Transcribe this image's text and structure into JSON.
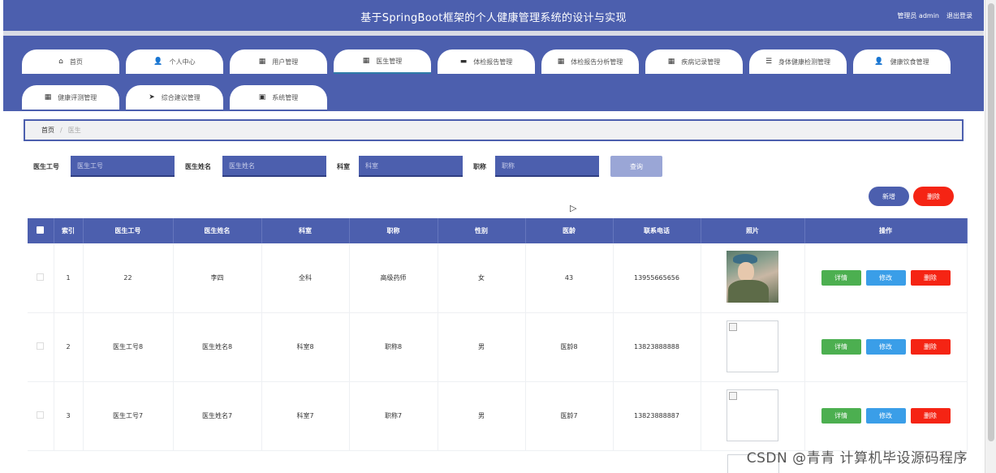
{
  "header": {
    "title": "基于SpringBoot框架的个人健康管理系统的设计与实现",
    "user_label": "管理员 admin",
    "logout_label": "退出登录"
  },
  "nav": {
    "tabs": [
      {
        "label": "首页",
        "icon": "home-icon",
        "glyph": "⌂"
      },
      {
        "label": "个人中心",
        "icon": "user-icon",
        "glyph": "👤"
      },
      {
        "label": "用户管理",
        "icon": "grid-icon",
        "glyph": "▦"
      },
      {
        "label": "医生管理",
        "icon": "grid-icon",
        "glyph": "▦"
      },
      {
        "label": "体检报告管理",
        "icon": "briefcase-icon",
        "glyph": "▬"
      },
      {
        "label": "体检报告分析管理",
        "icon": "grid-icon",
        "glyph": "▦"
      },
      {
        "label": "疾病记录管理",
        "icon": "grid-icon",
        "glyph": "▦"
      },
      {
        "label": "身体健康检测管理",
        "icon": "sliders-icon",
        "glyph": "☰"
      },
      {
        "label": "健康饮食管理",
        "icon": "user-icon",
        "glyph": "👤"
      },
      {
        "label": "健康评测管理",
        "icon": "grid-icon",
        "glyph": "▦"
      },
      {
        "label": "综合建议管理",
        "icon": "send-icon",
        "glyph": "➤"
      },
      {
        "label": "系统管理",
        "icon": "briefcase-icon",
        "glyph": "▣"
      }
    ]
  },
  "breadcrumb": {
    "home": "首页",
    "separator": "/",
    "current": "医生"
  },
  "search": {
    "fields": [
      {
        "label": "医生工号",
        "placeholder": "医生工号"
      },
      {
        "label": "医生姓名",
        "placeholder": "医生姓名"
      },
      {
        "label": "科室",
        "placeholder": "科室"
      },
      {
        "label": "职称",
        "placeholder": "职称"
      }
    ],
    "button_label": "查询"
  },
  "toolbar": {
    "add_label": "新增",
    "delete_label": "删除"
  },
  "table": {
    "columns": [
      "",
      "索引",
      "医生工号",
      "医生姓名",
      "科室",
      "职称",
      "性别",
      "医龄",
      "联系电话",
      "照片",
      "操作"
    ],
    "rows": [
      {
        "index": "1",
        "id": "22",
        "name": "李四",
        "dept": "全科",
        "title": "高级药师",
        "gender": "女",
        "years": "43",
        "phone": "13955665656",
        "photo": "real"
      },
      {
        "index": "2",
        "id": "医生工号8",
        "name": "医生姓名8",
        "dept": "科室8",
        "title": "职称8",
        "gender": "男",
        "years": "医龄8",
        "phone": "13823888888",
        "photo": "broken"
      },
      {
        "index": "3",
        "id": "医生工号7",
        "name": "医生姓名7",
        "dept": "科室7",
        "title": "职称7",
        "gender": "男",
        "years": "医龄7",
        "phone": "13823888887",
        "photo": "broken"
      }
    ],
    "actions": {
      "detail": "详情",
      "edit": "修改",
      "delete": "删除"
    }
  },
  "watermark": "CSDN @青青  计算机毕设源码程序",
  "colors": {
    "primary": "#4c5fae",
    "danger": "#f52414",
    "success": "#4caf50",
    "info": "#3a9ee8"
  }
}
